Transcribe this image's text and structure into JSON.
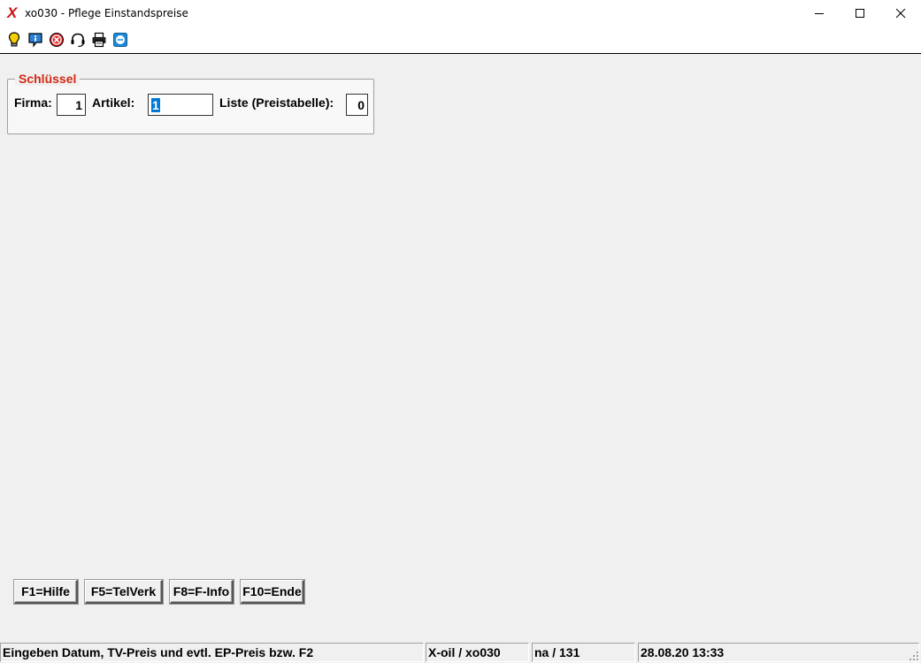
{
  "window": {
    "title": "xo030 - Pflege Einstandspreise",
    "logo_glyph": "X",
    "controls": [
      "minimize-icon",
      "maximize-icon",
      "close-icon"
    ]
  },
  "toolbar": {
    "icons": [
      "lightbulb-icon",
      "info-icon",
      "stop-icon",
      "headset-icon",
      "printer-icon",
      "remote-support-icon"
    ]
  },
  "key_group": {
    "legend": "Schlüssel",
    "firma": {
      "label": "Firma:",
      "value": "1"
    },
    "artikel": {
      "label": "Artikel:",
      "value": "1"
    },
    "liste": {
      "label": "Liste (Preistabelle):",
      "value": "0"
    }
  },
  "function_keys": [
    {
      "label": "F1=Hilfe"
    },
    {
      "label": "F5=TelVerk"
    },
    {
      "label": "F8=F-Info"
    },
    {
      "label": "F10=Ende"
    }
  ],
  "statusbar": {
    "message": "Eingeben Datum, TV-Preis und evtl. EP-Preis bzw. F2",
    "program": "X-oil / xo030",
    "user": "na / 131",
    "datetime": "28.08.20 13:33"
  },
  "colors": {
    "legend": "#d22a14",
    "selection": "#0078d7",
    "logo": "#cc1111"
  }
}
